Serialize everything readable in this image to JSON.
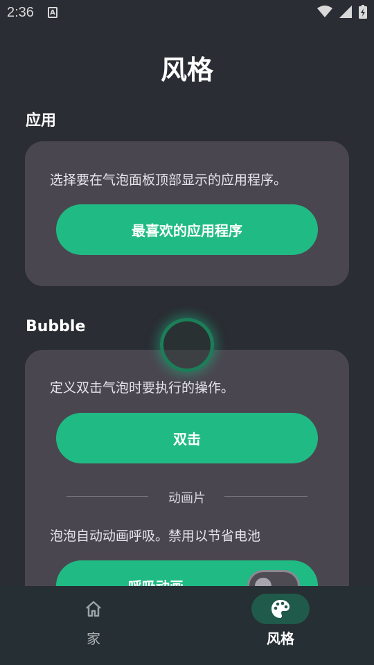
{
  "status_bar": {
    "time": "2:36"
  },
  "page": {
    "title": "风格"
  },
  "apps_section": {
    "label": "应用",
    "description": "选择要在气泡面板顶部显示的应用程序。",
    "button_label": "最喜欢的应用程序"
  },
  "bubble_section": {
    "label": "Bubble",
    "description": "定义双击气泡时要执行的操作。",
    "double_tap_button": "双击",
    "animation_divider": "动画片",
    "animation_description": "泡泡自动动画呼吸。禁用以节省电池",
    "breathing_button": "呼吸动画",
    "breathing_toggle_on": false
  },
  "bottom_nav": {
    "items": [
      {
        "label": "家",
        "icon": "home-icon",
        "active": false
      },
      {
        "label": "风格",
        "icon": "palette-icon",
        "active": true
      }
    ]
  },
  "colors": {
    "background": "#2a2d33",
    "card": "#4a464f",
    "accent": "#20bb84",
    "nav_background": "#262f33",
    "nav_active_pill": "#1f5a4a"
  }
}
